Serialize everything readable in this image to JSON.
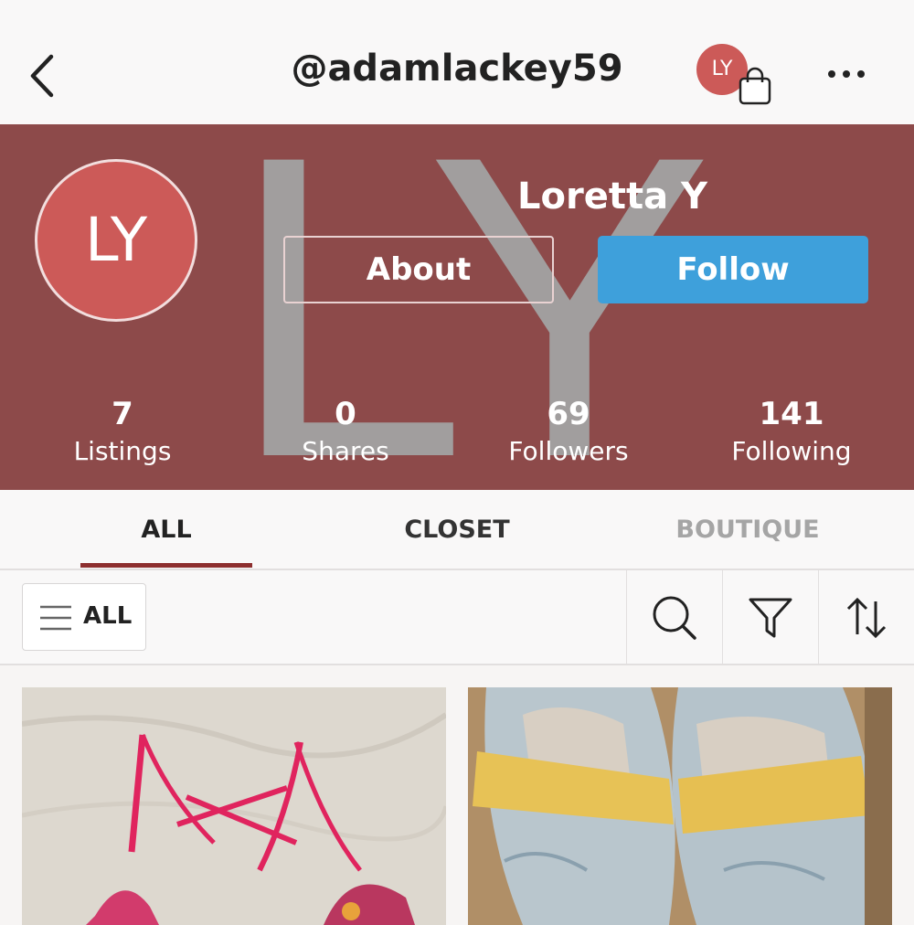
{
  "nav": {
    "handle": "@adamlackey59",
    "avatar_initials": "LY",
    "back_icon": "chevron-left-icon",
    "bag_icon": "shopping-bag-icon",
    "more_icon": "more-horizontal-icon"
  },
  "profile": {
    "initials": "LY",
    "watermark": "LY",
    "name": "Loretta Y",
    "about_label": "About",
    "follow_label": "Follow"
  },
  "stats": [
    {
      "value": "7",
      "label": "Listings"
    },
    {
      "value": "0",
      "label": "Shares"
    },
    {
      "value": "69",
      "label": "Followers"
    },
    {
      "value": "141",
      "label": "Following"
    }
  ],
  "tabs": [
    {
      "label": "ALL"
    },
    {
      "label": "CLOSET"
    },
    {
      "label": "BOUTIQUE"
    }
  ],
  "filterbar": {
    "all_label": "ALL",
    "search_icon": "search-icon",
    "filter_icon": "filter-funnel-icon",
    "sort_icon": "sort-arrows-icon"
  },
  "colors": {
    "banner": "#8d4a4a",
    "avatar": "#cc5a58",
    "follow": "#3ea0db",
    "tab_underline": "#8d2f2f"
  }
}
